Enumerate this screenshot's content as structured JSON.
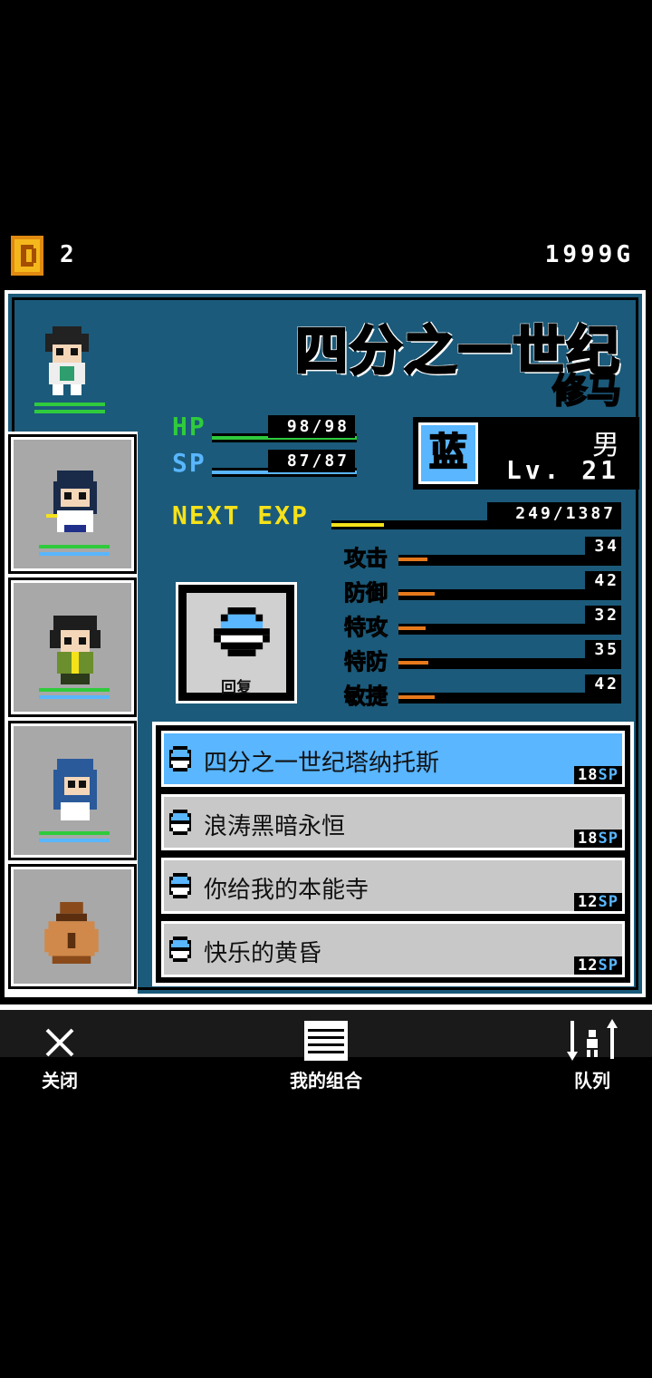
{
  "header": {
    "coin_count": "2",
    "gold": "1999G"
  },
  "character": {
    "name": "四分之一世纪",
    "subtitle": "修马",
    "type_label": "蓝",
    "gender": "男",
    "level": "Lv. 21"
  },
  "stats": {
    "hp_label": "HP",
    "hp_value": "98/98",
    "hp_fraction": 1.0,
    "sp_label": "SP",
    "sp_value": "87/87",
    "sp_fraction": 1.0,
    "exp_label": "NEXT EXP",
    "exp_value": "249/1387",
    "exp_fraction": 0.18
  },
  "attributes": [
    {
      "label": "攻击",
      "value": "34"
    },
    {
      "label": "防御",
      "value": "42"
    },
    {
      "label": "特攻",
      "value": "32"
    },
    {
      "label": "特防",
      "value": "35"
    },
    {
      "label": "敏捷",
      "value": "42"
    }
  ],
  "recover_label": "回复",
  "skills": [
    {
      "name": "四分之一世纪塔纳托斯",
      "cost": "18",
      "unit": "SP",
      "active": true
    },
    {
      "name": "浪涛黑暗永恒",
      "cost": "18",
      "unit": "SP",
      "active": false
    },
    {
      "name": "你给我的本能寺",
      "cost": "12",
      "unit": "SP",
      "active": false
    },
    {
      "name": "快乐的黄昏",
      "cost": "12",
      "unit": "SP",
      "active": false
    }
  ],
  "nav": {
    "close": "关闭",
    "combo": "我的组合",
    "queue": "队列"
  },
  "colors": {
    "panel": "#1b5a7a",
    "accent_blue": "#59b6ff",
    "hp_green": "#2fcb3c",
    "exp_yellow": "#f5e21a",
    "attr_orange": "#e6791c"
  }
}
